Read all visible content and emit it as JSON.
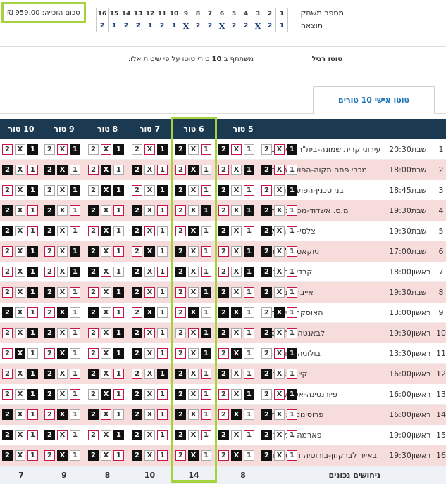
{
  "prize": {
    "label": "סכום הזכייה:",
    "value": "959.00",
    "currency": "₪"
  },
  "game_grid": {
    "header_label": "מספר משחק",
    "result_label": "תוצאה",
    "numbers": [
      "16",
      "15",
      "14",
      "13",
      "12",
      "11",
      "10",
      "9",
      "8",
      "7",
      "6",
      "5",
      "4",
      "3",
      "2",
      "1"
    ],
    "results": [
      "2",
      "1",
      "2",
      "2",
      "1",
      "2",
      "1",
      "X",
      "2",
      "2",
      "X",
      "2",
      "2",
      "X",
      "2",
      "1"
    ]
  },
  "form": {
    "type_label": "טוטו רגיל",
    "participation_prefix": "משתתף ב",
    "participation_count": "10",
    "participation_suffix": "טורי טוטו על פי שיטות אלו:"
  },
  "tabs": {
    "personal": "טוטו אישי 10 טורים"
  },
  "columns": [
    "5 טור",
    "6 טור",
    "7 טור",
    "8 טור",
    "9 טור",
    "10 טור"
  ],
  "accent": {
    "selected": "#c4184b",
    "header": "#1b3a52",
    "highlight": "#a6d23f",
    "row_pink": "#f7dcdc"
  },
  "matches": [
    {
      "n": "1",
      "day": "שבת",
      "time": "20:30",
      "teams": "עירוני קרית שמונה-בית\"ר ירושלים"
    },
    {
      "n": "2",
      "day": "שבת",
      "time": "18:00",
      "teams": "מכבי פתח תקוה-הפועל חיפה"
    },
    {
      "n": "3",
      "day": "שבת",
      "time": "18:45",
      "teams": "בני סכנין-הפועל חדרה"
    },
    {
      "n": "4",
      "day": "שבת",
      "time": "19:30",
      "teams": "מ.ס. אשדוד-מכבי נתניה"
    },
    {
      "n": "5",
      "day": "שבת",
      "time": "19:30",
      "teams": "צלסי-ליברפול"
    },
    {
      "n": "6",
      "day": "שבת",
      "time": "17:00",
      "teams": "ניוקאסל-לסטר"
    },
    {
      "n": "7",
      "day": "ראשון",
      "time": "18:00",
      "teams": "קרדיף-ברנלי"
    },
    {
      "n": "8",
      "day": "שבת",
      "time": "19:30",
      "teams": "אייבר-סביליה"
    },
    {
      "n": "9",
      "day": "ראשון",
      "time": "13:00",
      "teams": "האוסקה-ג'ירונה"
    },
    {
      "n": "10",
      "day": "ראשון",
      "time": "19:30",
      "teams": "לבאנטה-אלאבס"
    },
    {
      "n": "11",
      "day": "ראשון",
      "time": "13:30",
      "teams": "בולוניה-אודינזה"
    },
    {
      "n": "12",
      "day": "ראשון",
      "time": "16:00",
      "teams": "קייבו-טורינו"
    },
    {
      "n": "13",
      "day": "ראשון",
      "time": "16:00",
      "teams": "פיורנטינה-אטאלנטה"
    },
    {
      "n": "14",
      "day": "ראשון",
      "time": "16:00",
      "teams": "פרוסינונה-גנואה"
    },
    {
      "n": "15",
      "day": "ראשון",
      "time": "19:00",
      "teams": "פארמה-אמפולי"
    },
    {
      "n": "16",
      "day": "ראשון",
      "time": "19:30",
      "teams": "באייר לברקוזן-בורוסיה דורטמונד"
    }
  ],
  "cell_labels": [
    "1",
    "X",
    "2"
  ],
  "grid_states": [
    [
      [
        0,
        1,
        2
      ],
      [
        2,
        1,
        0
      ],
      [
        2,
        0,
        1
      ],
      [
        0,
        1,
        2
      ],
      [
        0,
        1,
        2
      ],
      [
        0,
        1,
        2
      ],
      [
        1,
        0,
        2
      ]
    ],
    [
      [
        2,
        1,
        0
      ],
      [
        1,
        0,
        2
      ],
      [
        1,
        2,
        0
      ],
      [
        2,
        0,
        1
      ],
      [
        1,
        2,
        0
      ],
      [
        2,
        2,
        0
      ],
      [
        2,
        0,
        1
      ]
    ],
    [
      [
        1,
        0,
        2
      ],
      [
        2,
        0,
        1
      ],
      [
        2,
        0,
        1
      ],
      [
        1,
        0,
        2
      ],
      [
        0,
        2,
        2
      ],
      [
        0,
        0,
        2
      ],
      [
        1,
        0,
        2
      ]
    ],
    [
      [
        2,
        0,
        1
      ],
      [
        1,
        0,
        2
      ],
      [
        1,
        0,
        2
      ],
      [
        2,
        0,
        1
      ],
      [
        2,
        0,
        1
      ],
      [
        2,
        0,
        1
      ],
      [
        2,
        0,
        1
      ]
    ],
    [
      [
        2,
        0,
        1
      ],
      [
        2,
        0,
        1
      ],
      [
        1,
        2,
        0
      ],
      [
        2,
        1,
        0
      ],
      [
        1,
        2,
        0
      ],
      [
        2,
        0,
        1
      ],
      [
        2,
        0,
        1
      ]
    ],
    [
      [
        2,
        0,
        1
      ],
      [
        1,
        0,
        2
      ],
      [
        2,
        0,
        1
      ],
      [
        1,
        2,
        0
      ],
      [
        2,
        0,
        1
      ],
      [
        1,
        0,
        2
      ],
      [
        1,
        0,
        2
      ]
    ],
    [
      [
        2,
        0,
        1
      ],
      [
        1,
        0,
        2
      ],
      [
        2,
        0,
        1
      ],
      [
        2,
        0,
        1
      ],
      [
        2,
        1,
        0
      ],
      [
        1,
        0,
        2
      ],
      [
        1,
        0,
        2
      ]
    ],
    [
      [
        2,
        0,
        1
      ],
      [
        2,
        0,
        1
      ],
      [
        1,
        0,
        2
      ],
      [
        2,
        1,
        0
      ],
      [
        1,
        0,
        2
      ],
      [
        2,
        0,
        1
      ],
      [
        1,
        0,
        2
      ]
    ],
    [
      [
        0,
        2,
        1
      ],
      [
        2,
        2,
        0
      ],
      [
        1,
        2,
        0
      ],
      [
        1,
        2,
        0
      ],
      [
        2,
        0,
        1
      ],
      [
        1,
        2,
        0
      ],
      [
        2,
        0,
        1
      ]
    ],
    [
      [
        2,
        0,
        1
      ],
      [
        2,
        0,
        1
      ],
      [
        0,
        1,
        2
      ],
      [
        2,
        1,
        0
      ],
      [
        1,
        0,
        2
      ],
      [
        2,
        0,
        1
      ],
      [
        1,
        0,
        2
      ]
    ],
    [
      [
        0,
        1,
        2
      ],
      [
        1,
        2,
        0
      ],
      [
        1,
        0,
        2
      ],
      [
        2,
        0,
        1
      ],
      [
        1,
        0,
        2
      ],
      [
        1,
        2,
        0
      ],
      [
        1,
        2,
        0
      ]
    ],
    [
      [
        2,
        0,
        1
      ],
      [
        2,
        0,
        1
      ],
      [
        2,
        0,
        1
      ],
      [
        1,
        0,
        2
      ],
      [
        2,
        0,
        1
      ],
      [
        2,
        0,
        1
      ],
      [
        1,
        0,
        2
      ]
    ],
    [
      [
        0,
        1,
        2
      ],
      [
        1,
        0,
        2
      ],
      [
        2,
        0,
        1
      ],
      [
        2,
        0,
        1
      ],
      [
        0,
        2,
        1
      ],
      [
        2,
        0,
        1
      ],
      [
        1,
        0,
        2
      ]
    ],
    [
      [
        2,
        0,
        1
      ],
      [
        1,
        2,
        0
      ],
      [
        2,
        0,
        1
      ],
      [
        2,
        0,
        1
      ],
      [
        2,
        1,
        0
      ],
      [
        1,
        2,
        0
      ],
      [
        2,
        0,
        1
      ]
    ],
    [
      [
        2,
        0,
        1
      ],
      [
        2,
        0,
        1
      ],
      [
        2,
        0,
        1
      ],
      [
        2,
        0,
        1
      ],
      [
        1,
        0,
        2
      ],
      [
        2,
        1,
        0
      ],
      [
        2,
        0,
        1
      ]
    ],
    [
      [
        2,
        0,
        1
      ],
      [
        1,
        2,
        0
      ],
      [
        1,
        2,
        0
      ],
      [
        2,
        0,
        1
      ],
      [
        2,
        0,
        1
      ],
      [
        1,
        2,
        0
      ],
      [
        2,
        0,
        1
      ]
    ]
  ],
  "footer": {
    "label": "ניחושים נכונים",
    "counts": [
      "8",
      "14",
      "10",
      "8",
      "9",
      "7"
    ]
  }
}
